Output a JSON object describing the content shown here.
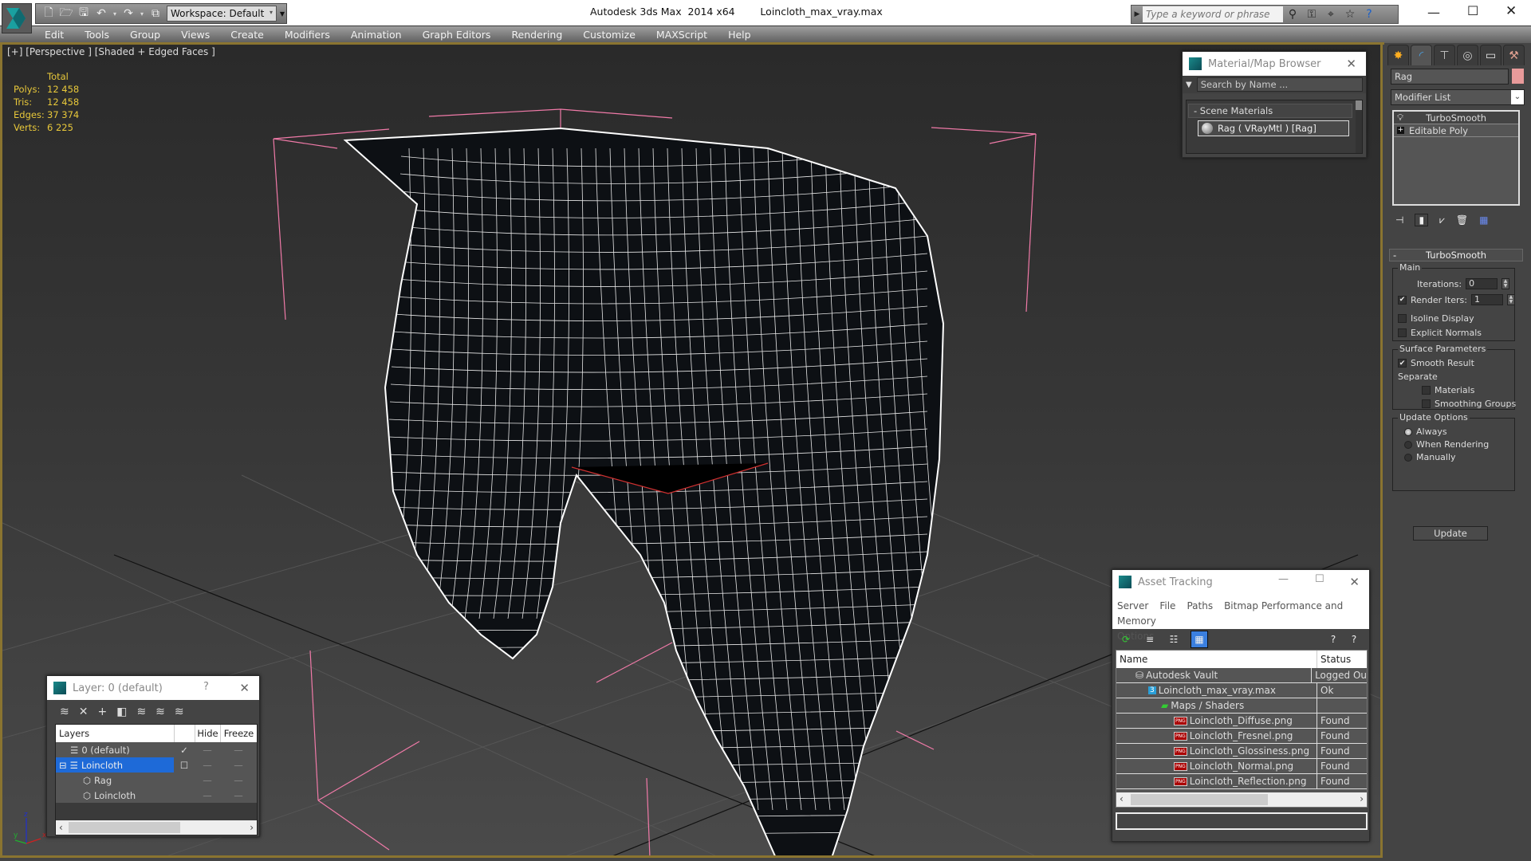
{
  "window": {
    "app_title": "Autodesk 3ds Max  2014 x64",
    "file_title": "Loincloth_max_vray.max",
    "minimize_icon": "minimize-icon",
    "maximize_icon": "maximize-icon",
    "close_icon": "close-icon"
  },
  "quick_access": {
    "workspace": "Workspace: Default",
    "icons": [
      "new-file-icon",
      "open-file-icon",
      "save-icon",
      "undo-icon",
      "redo-icon",
      "project-folder-icon"
    ]
  },
  "search": {
    "placeholder": "Type a keyword or phrase",
    "icons": [
      "binoculars-icon",
      "key-icon",
      "satellite-icon",
      "star-icon",
      "help-icon"
    ]
  },
  "menu": [
    "Edit",
    "Tools",
    "Group",
    "Views",
    "Create",
    "Modifiers",
    "Animation",
    "Graph Editors",
    "Rendering",
    "Customize",
    "MAXScript",
    "Help"
  ],
  "viewport": {
    "label": "[+] [Perspective ] [Shaded + Edged Faces ]",
    "stats": {
      "header": "Total",
      "rows": [
        {
          "label": "Polys:",
          "value": "12 458"
        },
        {
          "label": "Tris:",
          "value": "12 458"
        },
        {
          "label": "Edges:",
          "value": "37 374"
        },
        {
          "label": "Verts:",
          "value": "6 225"
        }
      ]
    },
    "axis": {
      "x": "x",
      "y": "y",
      "z": "z"
    }
  },
  "material_browser": {
    "title": "Material/Map Browser",
    "search_placeholder": "Search by Name ...",
    "category": "- Scene Materials",
    "material": "Rag  ( VRayMtl ) [Rag]"
  },
  "command_panel": {
    "tabs": [
      "create-tab",
      "modify-tab",
      "hierarchy-tab",
      "motion-tab",
      "display-tab",
      "utilities-tab"
    ],
    "object_name": "Rag",
    "object_color": "#e89a9a",
    "modifier_list": "Modifier List",
    "stack": [
      "TurboSmooth",
      "Editable Poly"
    ],
    "rollout": {
      "title": "TurboSmooth",
      "main_group": "Main",
      "iterations_label": "Iterations:",
      "iterations_value": "0",
      "render_iters_label": "Render Iters:",
      "render_iters_value": "1",
      "render_iters_checked": true,
      "isoline_label": "Isoline Display",
      "explicit_normals_label": "Explicit Normals",
      "surface_group": "Surface Parameters",
      "smooth_result_label": "Smooth Result",
      "separate_label": "Separate",
      "materials_label": "Materials",
      "smoothing_groups_label": "Smoothing Groups",
      "update_group": "Update Options",
      "update_options": [
        "Always",
        "When Rendering",
        "Manually"
      ],
      "update_selected": "Always",
      "update_button": "Update"
    }
  },
  "layer_dialog": {
    "title": "Layer: 0 (default)",
    "help": "?",
    "columns": [
      "Layers",
      "",
      "Hide",
      "Freeze"
    ],
    "rows": [
      {
        "name": "0 (default)",
        "current": "✓",
        "type": "layer"
      },
      {
        "name": "Loincloth",
        "current": "☐",
        "type": "layer",
        "selected": true,
        "expand": "⊟"
      },
      {
        "name": "Rag",
        "current": "",
        "type": "object"
      },
      {
        "name": "Loincloth",
        "current": "",
        "type": "object"
      }
    ],
    "hide_marker": "—",
    "freeze_marker": "—"
  },
  "asset_tracking": {
    "title": "Asset Tracking",
    "menu": [
      "Server",
      "File",
      "Paths",
      "Bitmap Performance and Memory",
      "Options"
    ],
    "columns": [
      "Name",
      "Status"
    ],
    "rows": [
      {
        "name": "Autodesk Vault",
        "status": "Logged Ou",
        "icon": "vault",
        "indent": 1
      },
      {
        "name": "Loincloth_max_vray.max",
        "status": "Ok",
        "icon": "max",
        "indent": 2
      },
      {
        "name": "Maps / Shaders",
        "status": "",
        "icon": "maps",
        "indent": 3
      },
      {
        "name": "Loincloth_Diffuse.png",
        "status": "Found",
        "icon": "png",
        "indent": 4
      },
      {
        "name": "Loincloth_Fresnel.png",
        "status": "Found",
        "icon": "png",
        "indent": 4
      },
      {
        "name": "Loincloth_Glossiness.png",
        "status": "Found",
        "icon": "png",
        "indent": 4
      },
      {
        "name": "Loincloth_Normal.png",
        "status": "Found",
        "icon": "png",
        "indent": 4
      },
      {
        "name": "Loincloth_Reflection.png",
        "status": "Found",
        "icon": "png",
        "indent": 4
      }
    ]
  }
}
